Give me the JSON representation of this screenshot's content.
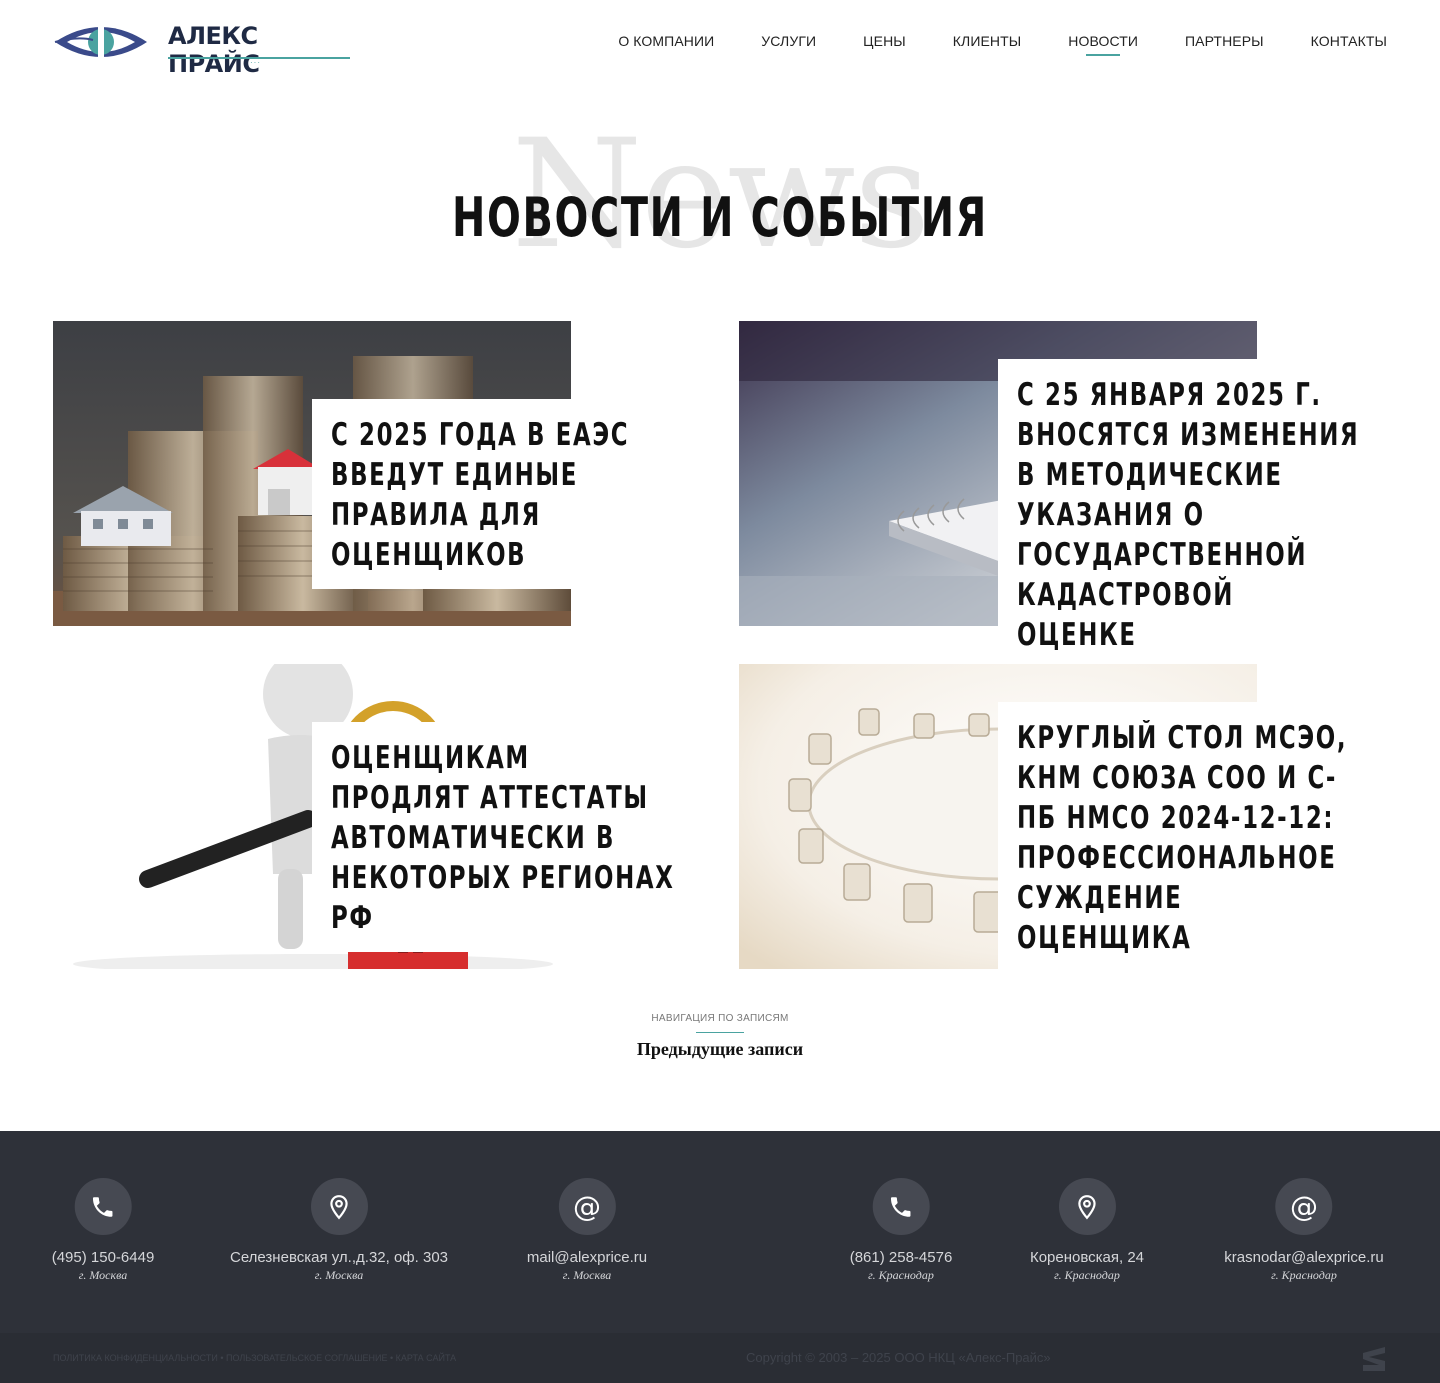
{
  "header": {
    "logo_text": "АЛЕКС ПРАЙС",
    "nav": [
      {
        "label": "О КОМПАНИИ"
      },
      {
        "label": "УСЛУГИ"
      },
      {
        "label": "ЦЕНЫ"
      },
      {
        "label": "КЛИЕНТЫ"
      },
      {
        "label": "НОВОСТИ",
        "active": true
      },
      {
        "label": "ПАРТНЕРЫ"
      },
      {
        "label": "КОНТАКТЫ"
      }
    ]
  },
  "hero": {
    "background_word": "News",
    "title": "НОВОСТИ И СОБЫТИЯ"
  },
  "news": [
    {
      "title": "С 2025 года в ЕАЭС введут единые правила для оценщиков",
      "image": "coins-and-houses"
    },
    {
      "title": "С 25 января 2025 г. вносятся изменения в методические указания о государственной кадастровой оценке",
      "image": "notebook-and-pen"
    },
    {
      "title": "Оценщикам продлят аттестаты автоматически в некоторых регионах РФ",
      "image": "figure-with-magnifier"
    },
    {
      "title": "Круглый стол МСЭО, КНМ Союза СОО и С-Пб НМСО 2024-12-12: профессиональное суждение оценщика",
      "image": "round-table"
    }
  ],
  "post_navigation": {
    "label": "НАВИГАЦИЯ ПО ЗАПИСЯМ",
    "previous": "Предыдущие записи"
  },
  "footer": {
    "contacts": [
      {
        "icon": "phone-icon",
        "text": "(495) 150-6449",
        "city": "г. Москва"
      },
      {
        "icon": "location-icon",
        "text": "Селезневская ул.,д.32, оф. 303",
        "city": "г. Москва"
      },
      {
        "icon": "at-icon",
        "text": "mail@alexprice.ru",
        "city": "г. Москва"
      },
      {
        "icon": "phone-icon",
        "text": "(861) 258-4576",
        "city": "г. Краснодар"
      },
      {
        "icon": "location-icon",
        "text": "Кореновская, 24",
        "city": "г. Краснодар"
      },
      {
        "icon": "at-icon",
        "text": "krasnodar@alexprice.ru",
        "city": "г. Краснодар"
      }
    ],
    "bottom_links": [
      "ПОЛИТИКА КОНФИДЕНЦИАЛЬНОСТИ",
      "ПОЛЬЗОВАТЕЛЬСКОЕ СОГЛАШЕНИЕ",
      "КАРТА САЙТА"
    ],
    "copyright": "Copyright © 2003 – 2025 ООО НКЦ «Алекс-Прайс»"
  },
  "colors": {
    "accent": "#4aa3a0",
    "footer_bg": "#2e3139",
    "footer_bottom_bg": "#2a2d34"
  }
}
